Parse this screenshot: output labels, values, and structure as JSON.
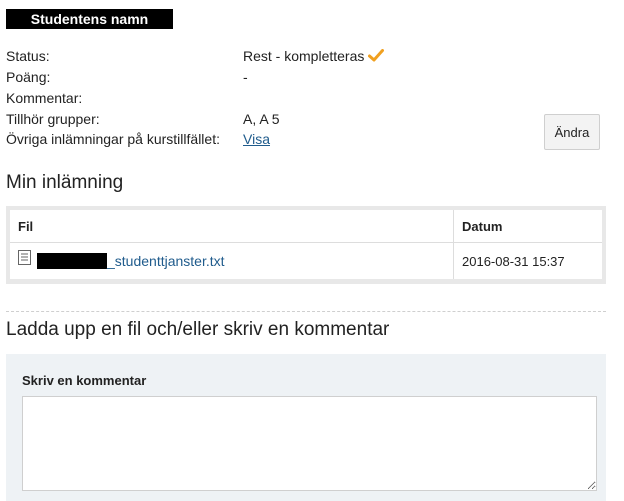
{
  "student": {
    "name": "Studentens namn"
  },
  "info": {
    "status_label": "Status:",
    "status_value": "Rest - kompletteras",
    "points_label": "Poäng:",
    "points_value": "-",
    "comment_label": "Kommentar:",
    "groups_label": "Tillhör grupper:",
    "groups_value": "A, A 5",
    "other_label": "Övriga inlämningar på kurstillfället:",
    "other_link": "Visa",
    "change_button": "Ändra"
  },
  "submission": {
    "title": "Min inlämning",
    "columns": {
      "file": "Fil",
      "date": "Datum"
    },
    "files": [
      {
        "name": "_studenttjanster.txt",
        "date": "2016-08-31 15:37",
        "icon": "document-icon"
      }
    ]
  },
  "upload": {
    "title": "Ladda upp en fil och/eller skriv en kommentar",
    "comment_label": "Skriv en kommentar",
    "comment_value": ""
  },
  "colors": {
    "link": "#1f5b8c",
    "check": "#f0a020",
    "panel_bg": "#eef2f5"
  }
}
